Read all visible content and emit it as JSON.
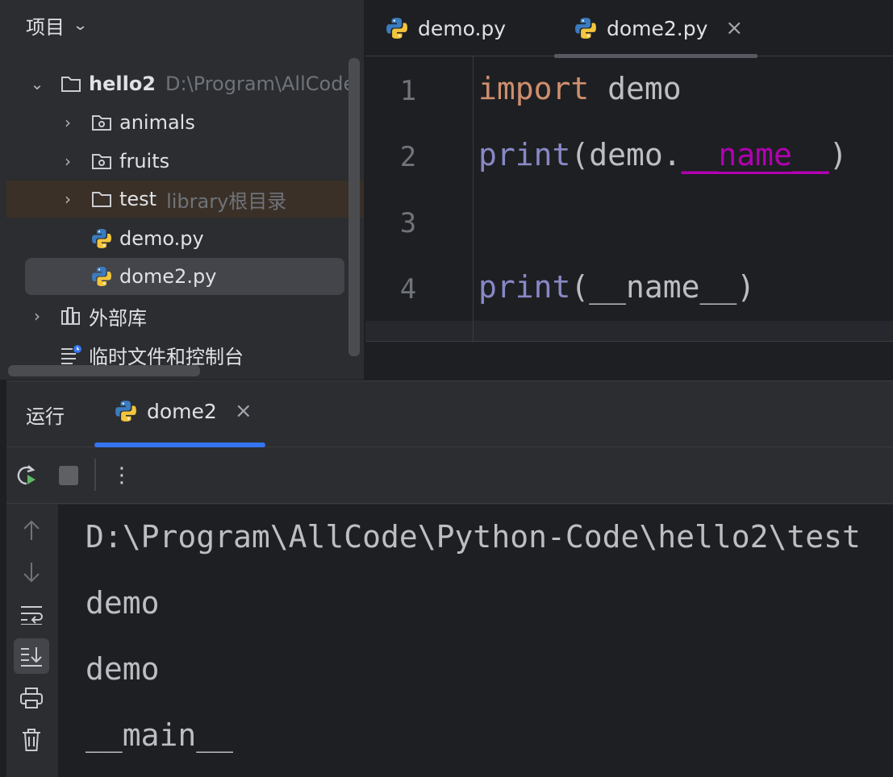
{
  "project": {
    "title": "项目",
    "root": {
      "name": "hello2",
      "path": "D:\\Program\\AllCode"
    },
    "items": [
      {
        "label": "animals"
      },
      {
        "label": "fruits"
      },
      {
        "label": "test",
        "hint": "library根目录"
      },
      {
        "label": "demo.py"
      },
      {
        "label": "dome2.py"
      },
      {
        "label": "外部库"
      },
      {
        "label": "临时文件和控制台"
      }
    ]
  },
  "editor": {
    "tabs": [
      {
        "label": "demo.py"
      },
      {
        "label": "dome2.py",
        "active": true
      }
    ],
    "close_glyph": "×",
    "line_numbers": [
      "1",
      "2",
      "3",
      "4"
    ],
    "code": {
      "line1": {
        "kw": "import",
        "rest": " demo"
      },
      "line2": {
        "fn": "print",
        "open": "(demo.",
        "dunder": "__name__",
        "close": ")"
      },
      "line4": {
        "fn": "print",
        "rest": "(__name__)"
      }
    }
  },
  "run": {
    "title": "运行",
    "tab": "dome2",
    "close_glyph": "×",
    "toolbar": {
      "more_glyph": "⋮"
    },
    "output": [
      "D:\\Program\\AllCode\\Python-Code\\hello2\\test",
      "demo",
      "demo",
      "__main__"
    ]
  },
  "colors": {
    "keyword": "#cf8e6d",
    "builtin": "#8888c6",
    "dunder": "#b200b2",
    "accent": "#3574f0"
  }
}
